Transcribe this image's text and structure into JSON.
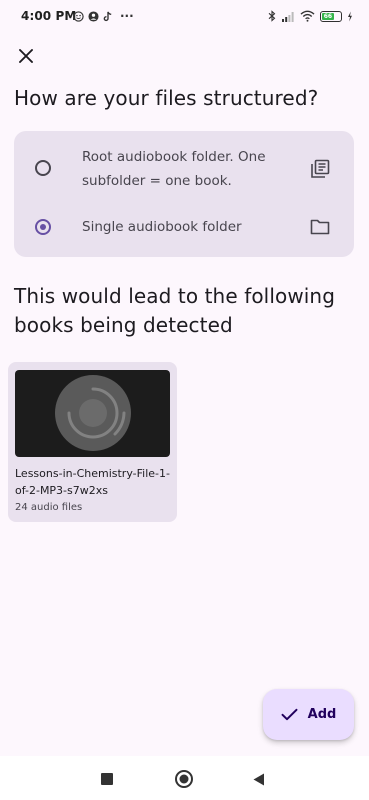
{
  "status_bar": {
    "time": "4:00 PM",
    "more": "···",
    "battery_level": "66"
  },
  "dialog": {
    "close_label": "Close",
    "heading": "How are your files structured?",
    "options": [
      {
        "label": "Root audiobook folder. One subfolder = one book.",
        "icon": "library-books-icon",
        "selected": false
      },
      {
        "label": "Single audiobook folder",
        "icon": "folder-icon",
        "selected": true
      }
    ],
    "results_heading": "This would lead to the following books being detected",
    "books": [
      {
        "title": "Lessons-in-Chemistry-File-1-of-2-MP3-s7w2xs",
        "file_count": "24 audio files"
      }
    ]
  },
  "fab": {
    "label": "Add",
    "icon": "check-icon"
  },
  "navigation": {
    "icons": [
      "square-recents-icon",
      "circle-home-icon",
      "triangle-back-icon"
    ]
  },
  "colors": {
    "background": "#fdf7fd",
    "card": "#e9e1ee",
    "accent": "#6750a4",
    "fab": "#eaddff"
  }
}
